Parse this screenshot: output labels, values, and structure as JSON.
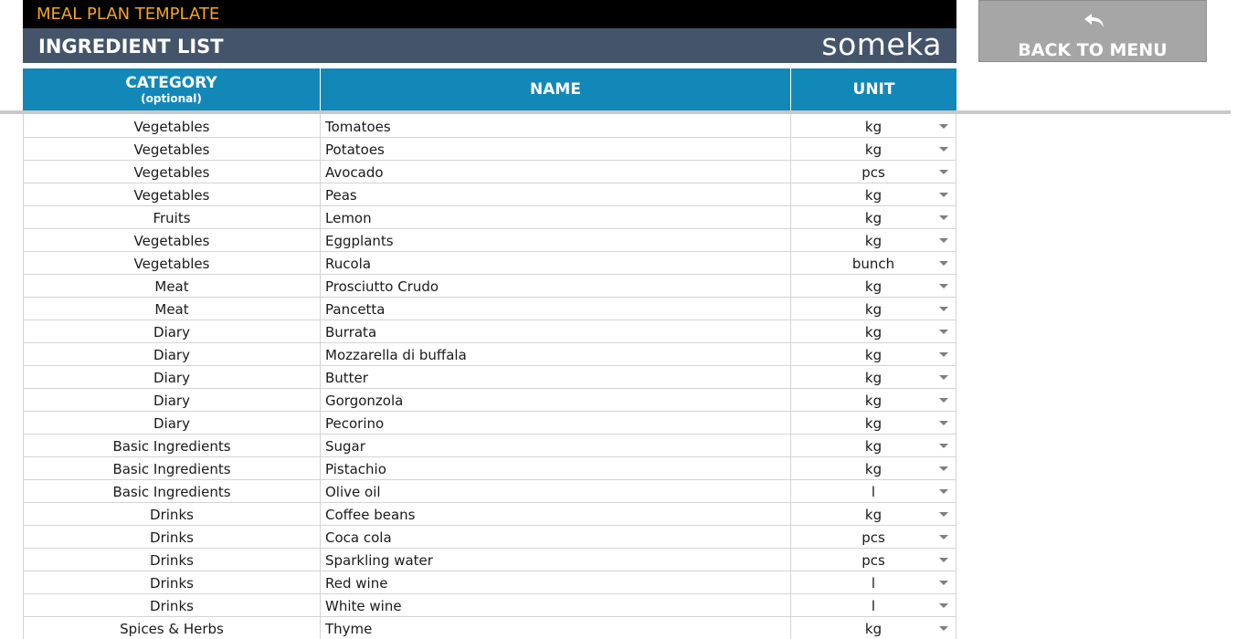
{
  "header": {
    "app_title": "MEAL PLAN TEMPLATE",
    "section_title": "INGREDIENT LIST",
    "brand": "someka"
  },
  "back_button": {
    "label": "BACK TO MENU",
    "icon": "undo-arrow-icon"
  },
  "colors": {
    "title_bar": "#000000",
    "title_text": "#f5a623",
    "section_bar": "#44546a",
    "table_header": "#1288b8",
    "button": "#a6a6a6"
  },
  "table": {
    "columns": [
      {
        "label": "CATEGORY",
        "sublabel": "(optional)"
      },
      {
        "label": "NAME",
        "sublabel": ""
      },
      {
        "label": "UNIT",
        "sublabel": ""
      }
    ],
    "rows": [
      {
        "category": "Vegetables",
        "name": "Tomatoes",
        "unit": "kg"
      },
      {
        "category": "Vegetables",
        "name": "Potatoes",
        "unit": "kg"
      },
      {
        "category": "Vegetables",
        "name": "Avocado",
        "unit": "pcs"
      },
      {
        "category": "Vegetables",
        "name": "Peas",
        "unit": "kg"
      },
      {
        "category": "Fruits",
        "name": "Lemon",
        "unit": "kg"
      },
      {
        "category": "Vegetables",
        "name": "Eggplants",
        "unit": "kg"
      },
      {
        "category": "Vegetables",
        "name": "Rucola",
        "unit": "bunch"
      },
      {
        "category": "Meat",
        "name": "Prosciutto Crudo",
        "unit": "kg"
      },
      {
        "category": "Meat",
        "name": "Pancetta",
        "unit": "kg"
      },
      {
        "category": "Diary",
        "name": "Burrata",
        "unit": "kg"
      },
      {
        "category": "Diary",
        "name": "Mozzarella di buffala",
        "unit": "kg"
      },
      {
        "category": "Diary",
        "name": "Butter",
        "unit": "kg"
      },
      {
        "category": "Diary",
        "name": "Gorgonzola",
        "unit": "kg"
      },
      {
        "category": "Diary",
        "name": "Pecorino",
        "unit": "kg"
      },
      {
        "category": "Basic Ingredients",
        "name": "Sugar",
        "unit": "kg"
      },
      {
        "category": "Basic Ingredients",
        "name": "Pistachio",
        "unit": "kg"
      },
      {
        "category": "Basic Ingredients",
        "name": "Olive oil",
        "unit": "l"
      },
      {
        "category": "Drinks",
        "name": "Coffee beans",
        "unit": "kg"
      },
      {
        "category": "Drinks",
        "name": "Coca cola",
        "unit": "pcs"
      },
      {
        "category": "Drinks",
        "name": "Sparkling water",
        "unit": "pcs"
      },
      {
        "category": "Drinks",
        "name": "Red wine",
        "unit": "l"
      },
      {
        "category": "Drinks",
        "name": "White wine",
        "unit": "l"
      },
      {
        "category": "Spices & Herbs",
        "name": "Thyme",
        "unit": "kg"
      }
    ]
  }
}
